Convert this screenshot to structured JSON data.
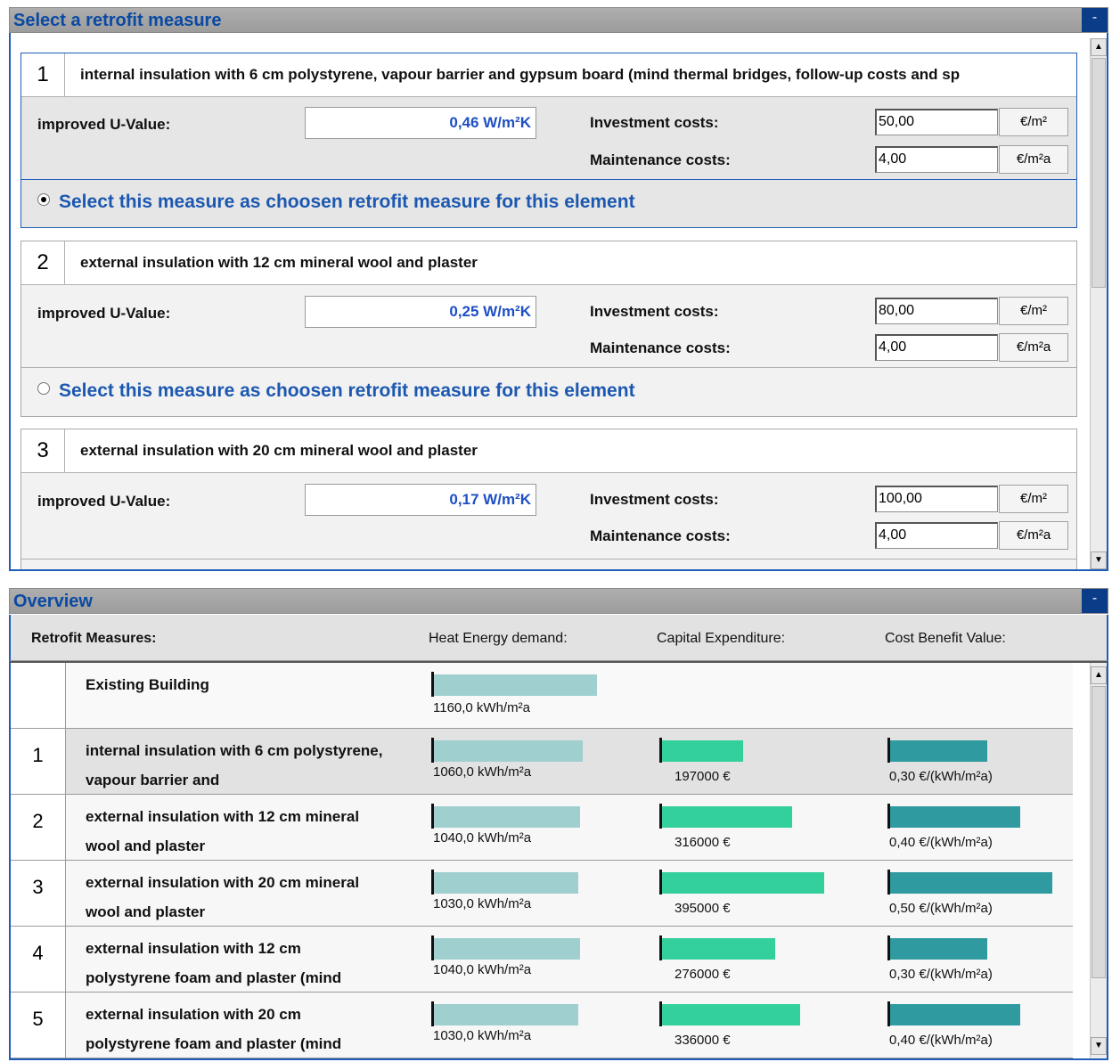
{
  "select_panel": {
    "title": "Select a retrofit measure",
    "minimize": "-",
    "measures": [
      {
        "number": "1",
        "title": "internal insulation with 6 cm polystyrene, vapour barrier and gypsum board (mind thermal bridges, follow-up costs and sp",
        "u_label": "improved U-Value:",
        "u_value": "0,46 W/m²K",
        "investment_label": "Investment costs:",
        "investment_value": "50,00",
        "investment_unit": "€/m²",
        "maintenance_label": "Maintenance costs:",
        "maintenance_value": "4,00",
        "maintenance_unit": "€/m²a",
        "select_text": "Select this measure as choosen retrofit measure for this element",
        "selected": true
      },
      {
        "number": "2",
        "title": "external insulation with 12 cm mineral wool and plaster",
        "u_label": "improved U-Value:",
        "u_value": "0,25 W/m²K",
        "investment_label": "Investment costs:",
        "investment_value": "80,00",
        "investment_unit": "€/m²",
        "maintenance_label": "Maintenance costs:",
        "maintenance_value": "4,00",
        "maintenance_unit": "€/m²a",
        "select_text": "Select this measure as choosen retrofit measure for this element",
        "selected": false
      },
      {
        "number": "3",
        "title": "external insulation with 20 cm mineral wool and plaster",
        "u_label": "improved U-Value:",
        "u_value": "0,17 W/m²K",
        "investment_label": "Investment costs:",
        "investment_value": "100,00",
        "investment_unit": "€/m²",
        "maintenance_label": "Maintenance costs:",
        "maintenance_value": "4,00",
        "maintenance_unit": "€/m²a"
      }
    ]
  },
  "overview": {
    "title": "Overview",
    "minimize": "-",
    "headers": {
      "measures": "Retrofit Measures:",
      "heat": "Heat Energy demand:",
      "capex": "Capital Expenditure:",
      "cbv": "Cost Benefit Value:"
    },
    "rows": [
      {
        "number": "",
        "name": "Existing Building",
        "heat_label": "1160,0 kWh/m²a",
        "heat_value": 1160
      },
      {
        "number": "1",
        "name": "internal insulation with 6 cm polystyrene, vapour barrier and",
        "heat_label": "1060,0 kWh/m²a",
        "heat_value": 1060,
        "capex_label": "197000 €",
        "capex_value": 197000,
        "cbv_label": "0,30 €/(kWh/m²a)",
        "cbv_value": 0.3,
        "highlighted": true
      },
      {
        "number": "2",
        "name": "external insulation with 12 cm mineral wool and plaster",
        "heat_label": "1040,0 kWh/m²a",
        "heat_value": 1040,
        "capex_label": "316000 €",
        "capex_value": 316000,
        "cbv_label": "0,40 €/(kWh/m²a)",
        "cbv_value": 0.4
      },
      {
        "number": "3",
        "name": "external insulation with 20 cm mineral wool and plaster",
        "heat_label": "1030,0 kWh/m²a",
        "heat_value": 1030,
        "capex_label": "395000 €",
        "capex_value": 395000,
        "cbv_label": "0,50 €/(kWh/m²a)",
        "cbv_value": 0.5
      },
      {
        "number": "4",
        "name": "external insulation with 12 cm polystyrene foam and plaster (mind",
        "heat_label": "1040,0 kWh/m²a",
        "heat_value": 1040,
        "capex_label": "276000 €",
        "capex_value": 276000,
        "cbv_label": "0,30 €/(kWh/m²a)",
        "cbv_value": 0.3
      },
      {
        "number": "5",
        "name": "external insulation with 20 cm polystyrene foam and plaster (mind",
        "heat_label": "1030,0 kWh/m²a",
        "heat_value": 1030,
        "capex_label": "336000 €",
        "capex_value": 336000,
        "cbv_label": "0,40 €/(kWh/m²a)",
        "cbv_value": 0.4
      }
    ]
  },
  "colors": {
    "accent": "#1f5db8",
    "title_text": "#0a4aa3",
    "heat_bar": "#9fcfcf",
    "capex_bar": "#33d09e",
    "cbv_bar": "#2f9aa0"
  }
}
